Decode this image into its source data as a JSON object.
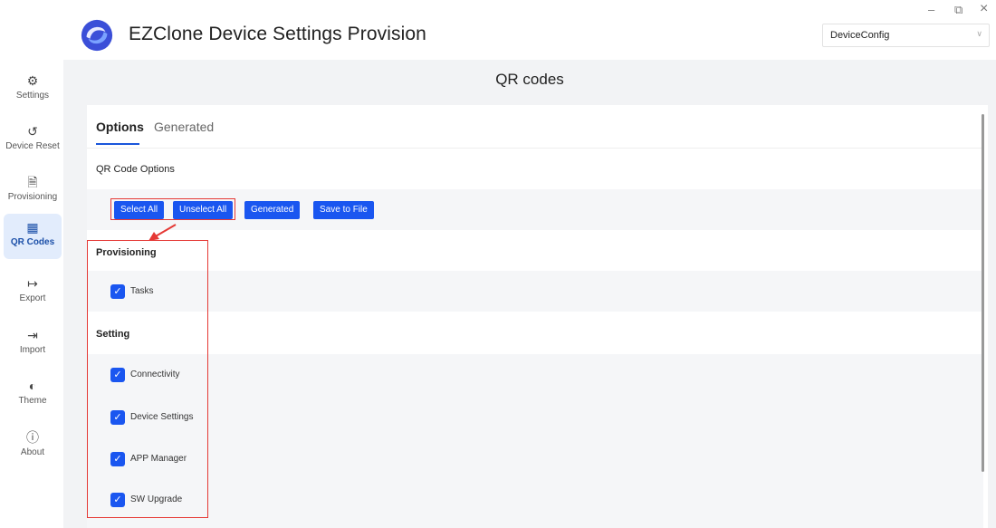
{
  "app": {
    "title": "EZClone Device Settings Provision",
    "config_select": "DeviceConfig",
    "window_controls": {
      "minimize": "–",
      "restore": "⧉",
      "close": "×"
    }
  },
  "sidebar": {
    "items": [
      {
        "label": "Settings",
        "icon": "gear-icon",
        "glyph": "⚙"
      },
      {
        "label": "Device Reset",
        "icon": "reset-icon",
        "glyph": "↺"
      },
      {
        "label": "Provisioning",
        "icon": "provisioning-icon",
        "glyph": "🗎"
      },
      {
        "label": "QR Codes",
        "icon": "qr-code-icon",
        "glyph": "▦",
        "active": true
      },
      {
        "label": "Export",
        "icon": "export-icon",
        "glyph": "↦"
      },
      {
        "label": "Import",
        "icon": "import-icon",
        "glyph": "⇥"
      },
      {
        "label": "Theme",
        "icon": "theme-icon",
        "glyph": "◐"
      },
      {
        "label": "About",
        "icon": "info-icon",
        "glyph": "ⓘ"
      }
    ]
  },
  "main": {
    "page_title": "QR codes",
    "tabs": [
      {
        "label": "Options",
        "active": true
      },
      {
        "label": "Generated",
        "active": false
      }
    ],
    "section_title": "QR Code Options",
    "buttons": {
      "select_all": "Select All",
      "unselect_all": "Unselect All",
      "generated": "Generated",
      "save_to_file": "Save to File"
    },
    "groups": [
      {
        "title": "Provisioning",
        "options": [
          {
            "label": "Tasks",
            "checked": true
          }
        ]
      },
      {
        "title": "Setting",
        "options": [
          {
            "label": "Connectivity",
            "checked": true
          },
          {
            "label": "Device Settings",
            "checked": true
          },
          {
            "label": "APP Manager",
            "checked": true
          },
          {
            "label": "SW Upgrade",
            "checked": true
          }
        ]
      }
    ],
    "checkmark": "✓"
  },
  "colors": {
    "accent": "#1a56f0",
    "annotation": "#e53935",
    "active_nav_bg": "#e2ecfc",
    "content_bg": "#f2f3f5"
  }
}
